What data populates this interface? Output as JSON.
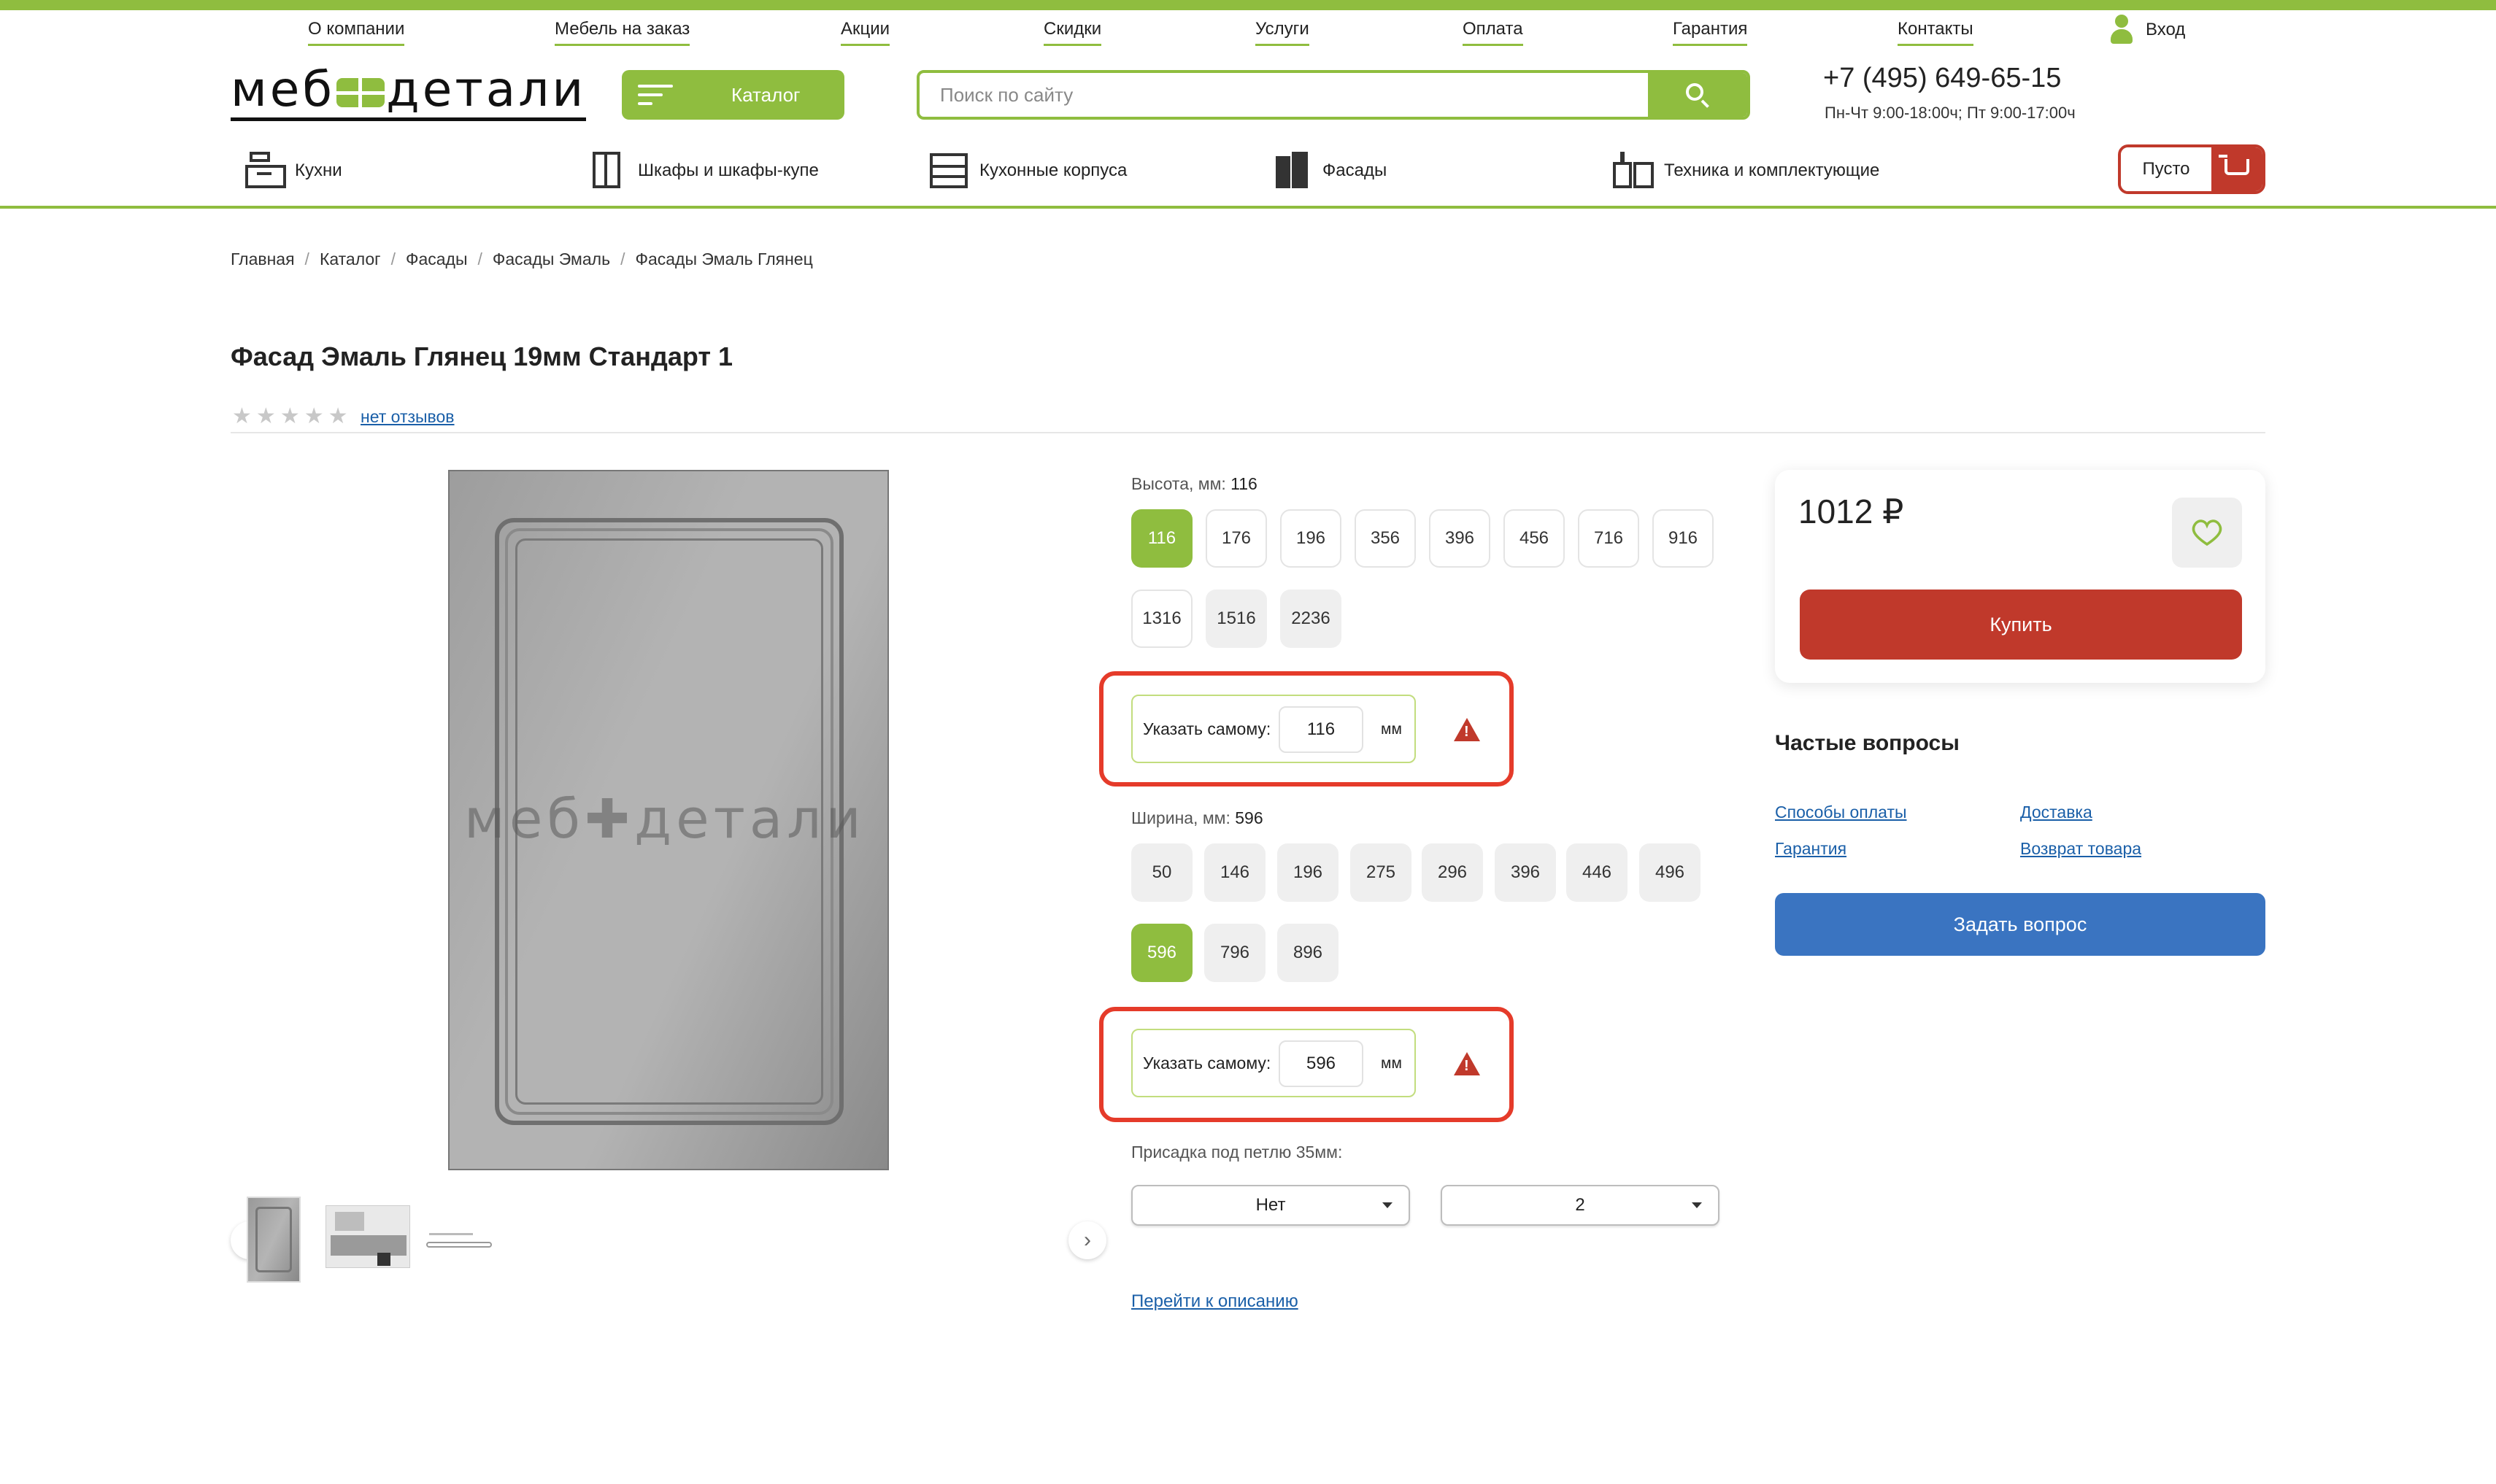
{
  "top_nav": [
    "О компании",
    "Мебель на заказ",
    "Акции",
    "Скидки",
    "Услуги",
    "Оплата",
    "Гарантия",
    "Контакты"
  ],
  "login_label": "Вход",
  "logo_text": {
    "left": "меб",
    "right": "детали"
  },
  "catalog_label": "Каталог",
  "search_placeholder": "Поиск по сайту",
  "phone": "+7 (495) 649-65-15",
  "hours": "Пн-Чт 9:00-18:00ч; Пт 9:00-17:00ч",
  "categories": [
    "Кухни",
    "Шкафы и шкафы-купе",
    "Кухонные корпуса",
    "Фасады",
    "Техника и комплектующие"
  ],
  "cart_label": "Пусто",
  "breadcrumbs": [
    "Главная",
    "Каталог",
    "Фасады",
    "Фасады Эмаль",
    "Фасады Эмаль Глянец"
  ],
  "product_title": "Фасад Эмаль Глянец 19мм Стандарт 1",
  "rating_stars": 0,
  "reviews_label": "нет отзывов",
  "image_watermark": {
    "left": "меб",
    "right": "детали"
  },
  "height": {
    "label": "Высота, мм:",
    "selected": "116",
    "options": [
      "116",
      "176",
      "196",
      "356",
      "396",
      "456",
      "716",
      "916",
      "1316",
      "1516",
      "2236"
    ],
    "custom_label": "Указать самому:",
    "custom_value": "116",
    "unit": "мм"
  },
  "width": {
    "label": "Ширина, мм:",
    "selected": "596",
    "options": [
      "50",
      "146",
      "196",
      "275",
      "296",
      "396",
      "446",
      "496",
      "596",
      "796",
      "896"
    ],
    "custom_label": "Указать самому:",
    "custom_value": "596",
    "unit": "мм"
  },
  "hinge": {
    "label": "Присадка под петлю 35мм:",
    "value_1": "Нет",
    "value_2": "2"
  },
  "to_description": "Перейти к описанию",
  "price": "1012 ₽",
  "buy_label": "Купить",
  "faq": {
    "title": "Частые вопросы",
    "links": [
      "Способы оплаты",
      "Доставка",
      "Гарантия",
      "Возврат товара"
    ]
  },
  "ask_label": "Задать вопрос",
  "colors": {
    "accent_green": "#8fbd3f",
    "red": "#c0392b",
    "blue": "#3a74c1",
    "alert_red": "#e53b2a"
  },
  "icons": [
    "user-icon",
    "menu-icon",
    "search-icon",
    "kitchen-icon",
    "wardrobe-icon",
    "cabinet-icon",
    "facade-icon",
    "appliance-icon",
    "cart-icon",
    "star-icon",
    "chevron-left-icon",
    "chevron-right-icon",
    "warning-icon",
    "heart-icon",
    "caret-down-icon"
  ]
}
